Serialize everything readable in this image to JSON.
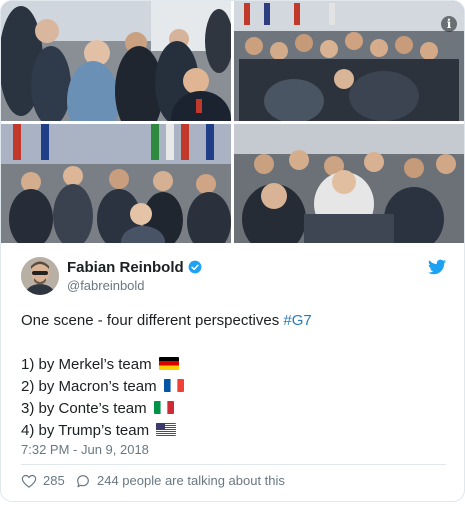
{
  "tweet": {
    "author_name": "Fabian Reinbold",
    "author_handle": "@fabreinbold",
    "text_intro": "One scene - four different perspectives ",
    "hashtag": "#G7",
    "lines": [
      {
        "text": "1) by Merkel’s team",
        "flag": "germany-flag"
      },
      {
        "text": "2) by Macron’s team",
        "flag": "france-flag"
      },
      {
        "text": "3) by Conte’s team",
        "flag": "italy-flag"
      },
      {
        "text": "4) by Trump’s team",
        "flag": "usa-flag"
      }
    ],
    "timestamp": "7:32 PM - Jun 9, 2018",
    "like_count": "285",
    "reply_text": "244 people are talking about this"
  },
  "icons": {
    "info": "info-icon",
    "verified": "verified-badge-icon",
    "twitter": "twitter-bird-icon",
    "like": "heart-icon",
    "reply": "speech-bubble-icon"
  },
  "colors": {
    "link": "#2b7bb9",
    "muted": "#697882",
    "text": "#1c2022",
    "twitter_blue": "#1da1f2"
  }
}
